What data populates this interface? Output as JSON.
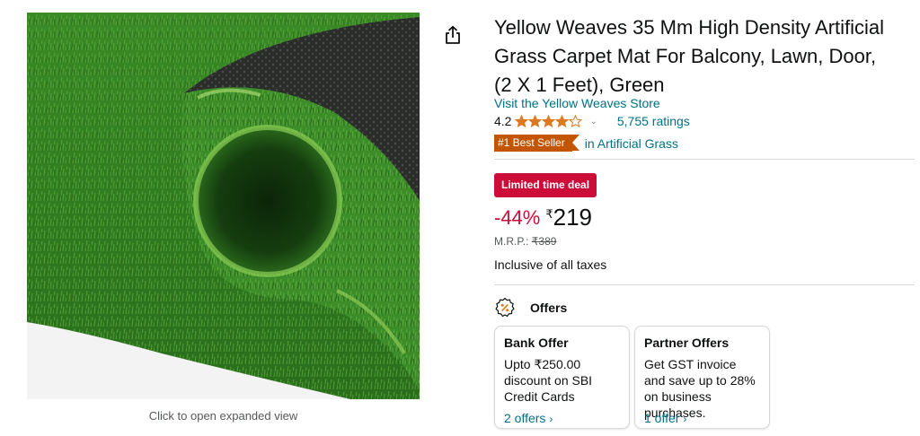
{
  "product": {
    "title": "Yellow Weaves 35 Mm High Density Artificial Grass Carpet Mat For Balcony, Lawn, Door, (2 X 1 Feet), Green",
    "image_caption": "Click to open expanded view",
    "share_icon": "share-icon",
    "store_link": "Visit the Yellow Weaves Store",
    "rating": {
      "value": "4.2",
      "stars": 4.2,
      "chevron": "⌄",
      "count_text": "5,755 ratings"
    },
    "bestseller": {
      "badge": "#1 Best Seller",
      "category": "in Artificial Grass"
    }
  },
  "pricing": {
    "deal_badge": "Limited time deal",
    "discount": "-44%",
    "currency": "₹",
    "price": "219",
    "mrp_label": "M.R.P.: ",
    "mrp_value": "₹389",
    "taxes_note": "Inclusive of all taxes"
  },
  "offers": {
    "heading": "Offers",
    "icon": "offer-percent-icon",
    "cards": [
      {
        "title": "Bank Offer",
        "description": "Upto ₹250.00 discount on SBI Credit Cards",
        "link": "2 offers",
        "chevron": "›"
      },
      {
        "title": "Partner Offers",
        "description": "Get GST invoice and save up to 28% on business purchases.",
        "link": "1 offer",
        "chevron": "›"
      }
    ]
  },
  "colors": {
    "link": "#007185",
    "deal": "#cc0c39",
    "bestseller": "#c45500",
    "star": "#de7921",
    "grass": "#3f8a2b"
  }
}
